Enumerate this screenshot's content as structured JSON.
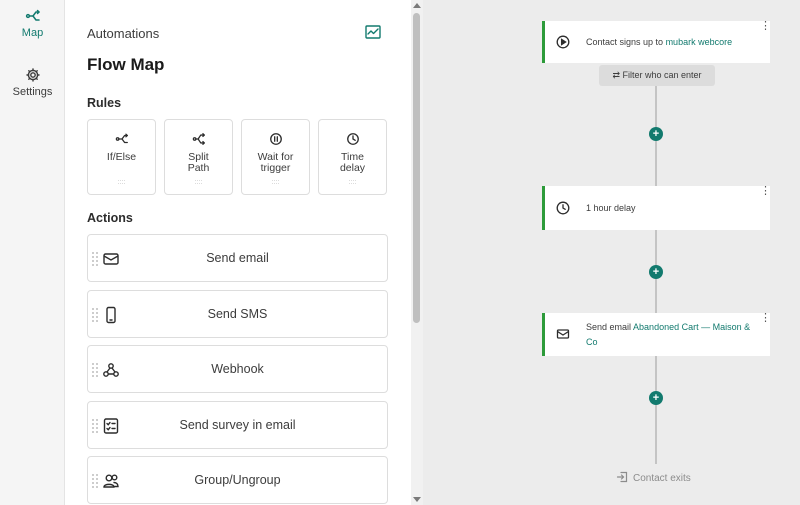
{
  "rail": {
    "map_label": "Map",
    "settings_label": "Settings"
  },
  "panel": {
    "breadcrumb": "Automations",
    "title": "Flow Map",
    "rules_heading": "Rules",
    "actions_heading": "Actions",
    "rules": [
      {
        "label": "If/Else",
        "icon": "branch-icon"
      },
      {
        "label": "Split Path",
        "icon": "split-icon"
      },
      {
        "label": "Wait for trigger",
        "icon": "pause-icon"
      },
      {
        "label": "Time delay",
        "icon": "clock-icon"
      }
    ],
    "actions": [
      {
        "label": "Send email",
        "icon": "envelope-icon"
      },
      {
        "label": "Send SMS",
        "icon": "phone-icon"
      },
      {
        "label": "Webhook",
        "icon": "webhook-icon"
      },
      {
        "label": "Send survey in email",
        "icon": "checklist-icon"
      },
      {
        "label": "Group/Ungroup",
        "icon": "group-icon"
      }
    ]
  },
  "flow": {
    "trigger_prefix": "Contact signs up to",
    "trigger_link": "mubark webcore",
    "filter_label": "Filter who can enter",
    "delay_label": "1 hour delay",
    "email_prefix": "Send email",
    "email_link_1": "Abandoned Cart — Maison &",
    "email_link_2": "Co",
    "exit_label": "Contact exits",
    "plus_symbol": "+",
    "kebab_symbol": "⋮"
  },
  "colors": {
    "accent": "#127a6e",
    "node_border": "#2d9b3a"
  }
}
